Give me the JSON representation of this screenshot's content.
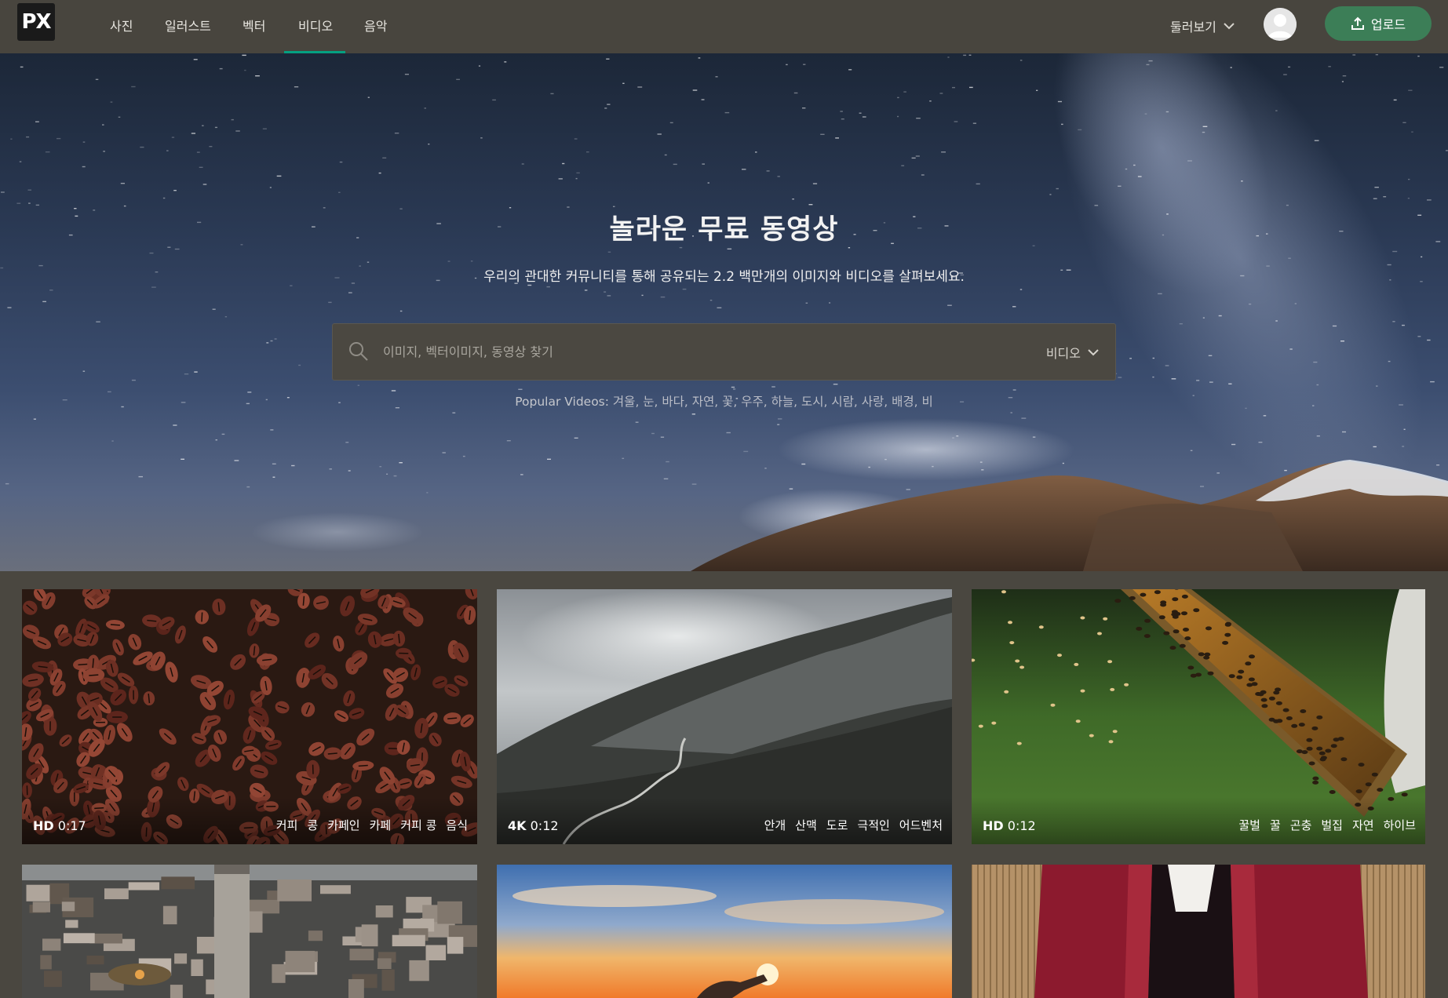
{
  "colors": {
    "accent": "#05a081",
    "upload_button": "#3c7e57",
    "nav_bg": "#48453e",
    "page_bg": "#4a4740"
  },
  "nav": {
    "logo_text": "PX",
    "items": [
      {
        "label": "사진",
        "active": false
      },
      {
        "label": "일러스트",
        "active": false
      },
      {
        "label": "벡터",
        "active": false
      },
      {
        "label": "비디오",
        "active": true
      },
      {
        "label": "음악",
        "active": false
      }
    ],
    "explore_label": "둘러보기",
    "upload_label": "업로드"
  },
  "hero": {
    "title": "놀라운 무료 동영상",
    "subtitle": "우리의 관대한 커뮤니티를 통해 공유되는 2.2 백만개의 이미지와 비디오를 살펴보세요.",
    "search_placeholder": "이미지, 벡터이미지, 동영상 찾기",
    "search_type": "비디오",
    "popular_label": "Popular Videos:",
    "popular_terms": "겨울, 눈, 바다, 자연, 꽃, 우주, 하늘, 도시, 시람, 사랑, 배경, 비"
  },
  "videos": [
    {
      "quality": "HD",
      "duration": "0:17",
      "tags": [
        "커피",
        "콩",
        "카페인",
        "카페",
        "커피 콩",
        "음식"
      ]
    },
    {
      "quality": "4K",
      "duration": "0:12",
      "tags": [
        "안개",
        "산맥",
        "도로",
        "극적인",
        "어드벤처"
      ]
    },
    {
      "quality": "HD",
      "duration": "0:12",
      "tags": [
        "꿀벌",
        "꿀",
        "곤충",
        "벌집",
        "자연",
        "하이브"
      ]
    },
    {
      "quality": "",
      "duration": "",
      "tags": []
    },
    {
      "quality": "",
      "duration": "",
      "tags": []
    },
    {
      "quality": "",
      "duration": "",
      "tags": []
    }
  ]
}
